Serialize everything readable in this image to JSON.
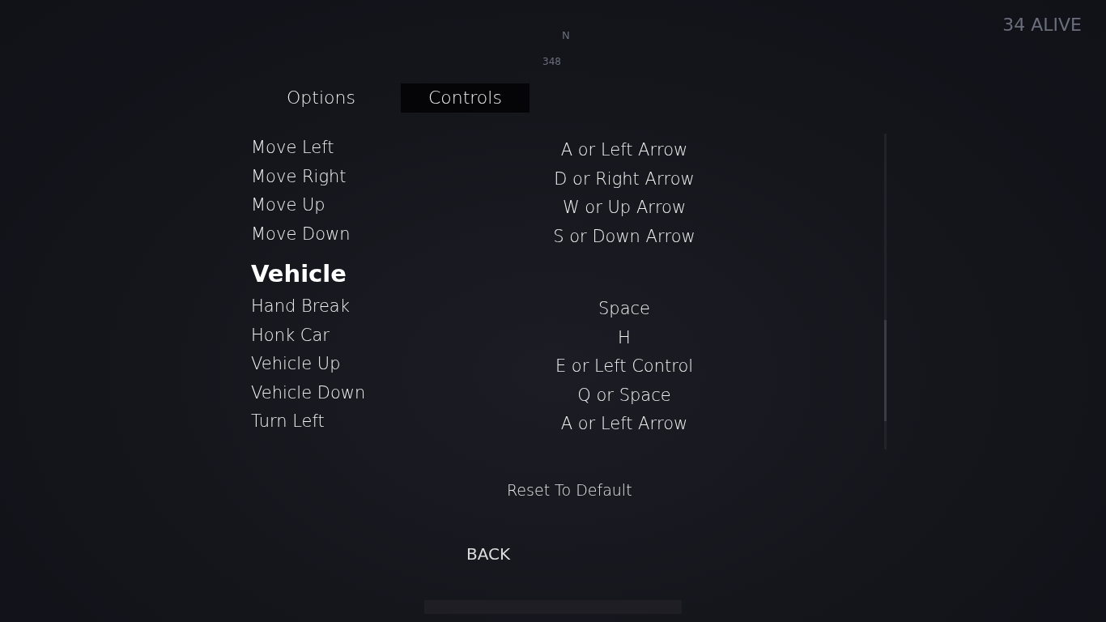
{
  "hud": {
    "compass_heading": "N",
    "bearing": "348",
    "alive_count": "34 ALIVE"
  },
  "tabs": [
    {
      "label": "Options",
      "selected": false
    },
    {
      "label": "Controls",
      "selected": true
    }
  ],
  "controls": [
    {
      "kind": "binding",
      "action": "Move Left",
      "key": "A or Left Arrow"
    },
    {
      "kind": "binding",
      "action": "Move Right",
      "key": "D or Right Arrow"
    },
    {
      "kind": "binding",
      "action": "Move Up",
      "key": "W or Up Arrow"
    },
    {
      "kind": "binding",
      "action": "Move Down",
      "key": "S or Down Arrow"
    },
    {
      "kind": "section",
      "action": "Vehicle"
    },
    {
      "kind": "binding",
      "action": "Hand Break",
      "key": "Space"
    },
    {
      "kind": "binding",
      "action": "Honk Car",
      "key": "H"
    },
    {
      "kind": "binding",
      "action": "Vehicle Up",
      "key": "E or Left Control"
    },
    {
      "kind": "binding",
      "action": "Vehicle Down",
      "key": "Q or Space"
    },
    {
      "kind": "binding",
      "action": "Turn Left",
      "key": "A or Left Arrow"
    }
  ],
  "reset_button": "Reset To Default",
  "back_button": "BACK"
}
